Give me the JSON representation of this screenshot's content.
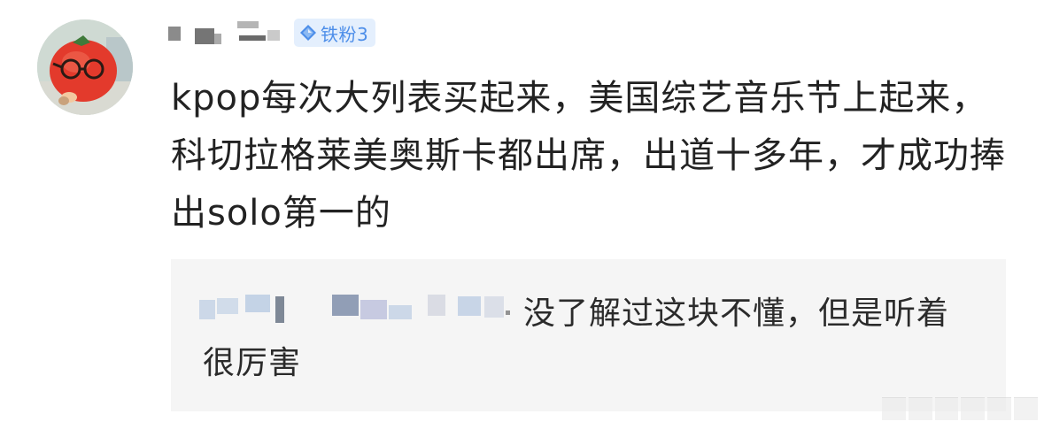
{
  "comment": {
    "badge": {
      "label": "铁粉3",
      "color": "#4d8ee9",
      "background": "#e4effd",
      "icon": "diamond-icon"
    },
    "text": "kpop每次大列表买起来，美国综艺音乐节上起来，科切拉格莱美奥斯卡都出席，出道十多年，才成功捧出solo第一的"
  },
  "reply": {
    "text": "没了解过这块不懂，但是听着很厉害"
  },
  "colors": {
    "text_primary": "#222222",
    "reply_background": "#f5f5f5",
    "reply_username": "#9bb6d9"
  }
}
